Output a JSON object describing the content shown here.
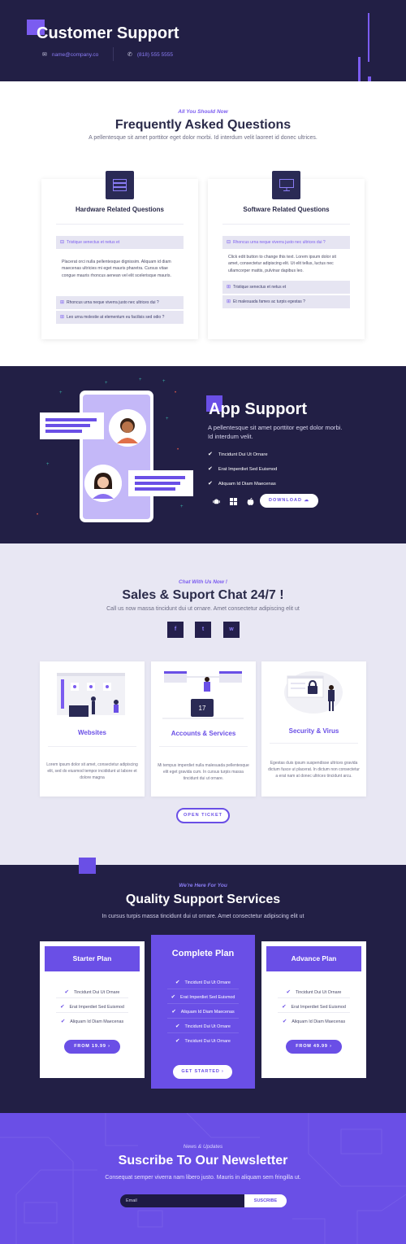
{
  "header": {
    "title": "Customer Support",
    "email": "name@company.co",
    "phone": "(818) 555 5555",
    "email_icon": "envelope-icon",
    "phone_icon": "phone-icon"
  },
  "faq": {
    "eyebrow": "All You Should Now",
    "title": "Frequently Asked Questions",
    "subtitle": "A pellentesque sit amet porttitor eget dolor morbi. Id interdum velit laoreet id donec ultrices.",
    "cards": [
      {
        "icon": "server-icon",
        "title": "Hardware Related Questions",
        "items": [
          "Tristique senectus et netus et",
          "Rhoncus urna neque viverra justo nec ultrices dui ?",
          "Leo urna molestie at elementum eu facilisis sed odio ?"
        ],
        "answer": "Placerat orci nulla pellentesque dignissim. Aliquam id diam maecenas ultricies mi eget mauris pharetra. Cursus vitae congue mauris rhoncus aenean vel elit scelerisque mauris."
      },
      {
        "icon": "monitor-icon",
        "title": "Software Related Questions",
        "items": [
          "Rhoncus urna neque viverra justo nec ultrices dui ?",
          "Tristique senectus et netus et",
          "Et malesuada fames ac turpis egestas ?"
        ],
        "answer": "Click edit button to change this text. Lorem ipsum dolor sit amet, consectetur adipiscing elit. Ut elit tellus, luctus nec ullamcorper mattis, pulvinar dapibus leo."
      }
    ]
  },
  "app_support": {
    "title": "App Support",
    "description": "A pellentesque sit amet porttitor eget dolor morbi. Id interdum velit.",
    "features": [
      "Tincidunt Dui Ut Ornare",
      "Erat Imperdiet Sed Euismod",
      "Aliquam Id Diam Maecenas"
    ],
    "store_icons": [
      "android-icon",
      "windows-icon",
      "apple-icon"
    ],
    "download_label": "DOWNLOAD",
    "download_icon": "cloud-icon"
  },
  "chat": {
    "eyebrow": "Chat With Us Now !",
    "title": "Sales & Suport Chat 24/7 !",
    "subtitle": "Call us now massa tincidunt dui ut ornare. Amet consectetur adipiscing elit ut",
    "social": [
      "f",
      "t",
      "w"
    ],
    "social_icons": [
      "facebook-icon",
      "twitter-icon",
      "whatsapp-icon"
    ],
    "services": [
      {
        "title": "Websites",
        "text": "Lorem ipsum dolor sit amet, consectetur adipiscing elit, sed do eiusmod tempor incididunt ut labore et dolore magna"
      },
      {
        "title": "Accounts & Services",
        "text": "Mi tempus imperdiet nulla malesuada pellentesque elit eget gravida cum. In cursus turpis massa tincidunt dui ut ornare."
      },
      {
        "title": "Security & Virus",
        "text": "Egestas duis ipsum suspendisse ultrices gravida dictum fusce ut placerat. In dictum non consectetur a erat nam at donec ultrices tincidunt arcu."
      }
    ],
    "ticket_label": "OPEN TICKET"
  },
  "pricing": {
    "eyebrow": "We're Here For You",
    "title": "Quality Support Services",
    "subtitle": "In cursus turpis massa tincidunt dui ut ornare. Amet consectetur adipiscing elit ut",
    "plans": [
      {
        "name": "Starter Plan",
        "features": [
          "Tincidunt Dui Ut Ornare",
          "Erat Imperdiet Sed Euismod",
          "Aliquam Id Diam Maecenas"
        ],
        "button": "FROM 19.99"
      },
      {
        "name": "Complete Plan",
        "features": [
          "Tincidunt Dui Ut Ornare",
          "Erat Imperdiet Sed Euismod",
          "Aliquam Id Diam Maecenas",
          "Tincidunt Dui Ut Ornare",
          "Tincidunt Dui Ut Ornare"
        ],
        "button": "GET STARTED"
      },
      {
        "name": "Advance Plan",
        "features": [
          "Tincidunt Dui Ut Ornare",
          "Erat Imperdiet Sed Euismod",
          "Aliquam Id Diam Maecenas"
        ],
        "button": "FROM 49.99"
      }
    ]
  },
  "newsletter": {
    "eyebrow": "News & Updates",
    "title": "Suscribe To Our Newsletter",
    "subtitle": "Consequat semper viverra nam libero justo. Mauris in aliquam sem fringilla ut.",
    "placeholder": "Email",
    "button": "SUSCRIBE"
  },
  "colors": {
    "accent": "#6a4fe6",
    "dark": "#221f45",
    "light_bg": "#e8e7f3"
  }
}
